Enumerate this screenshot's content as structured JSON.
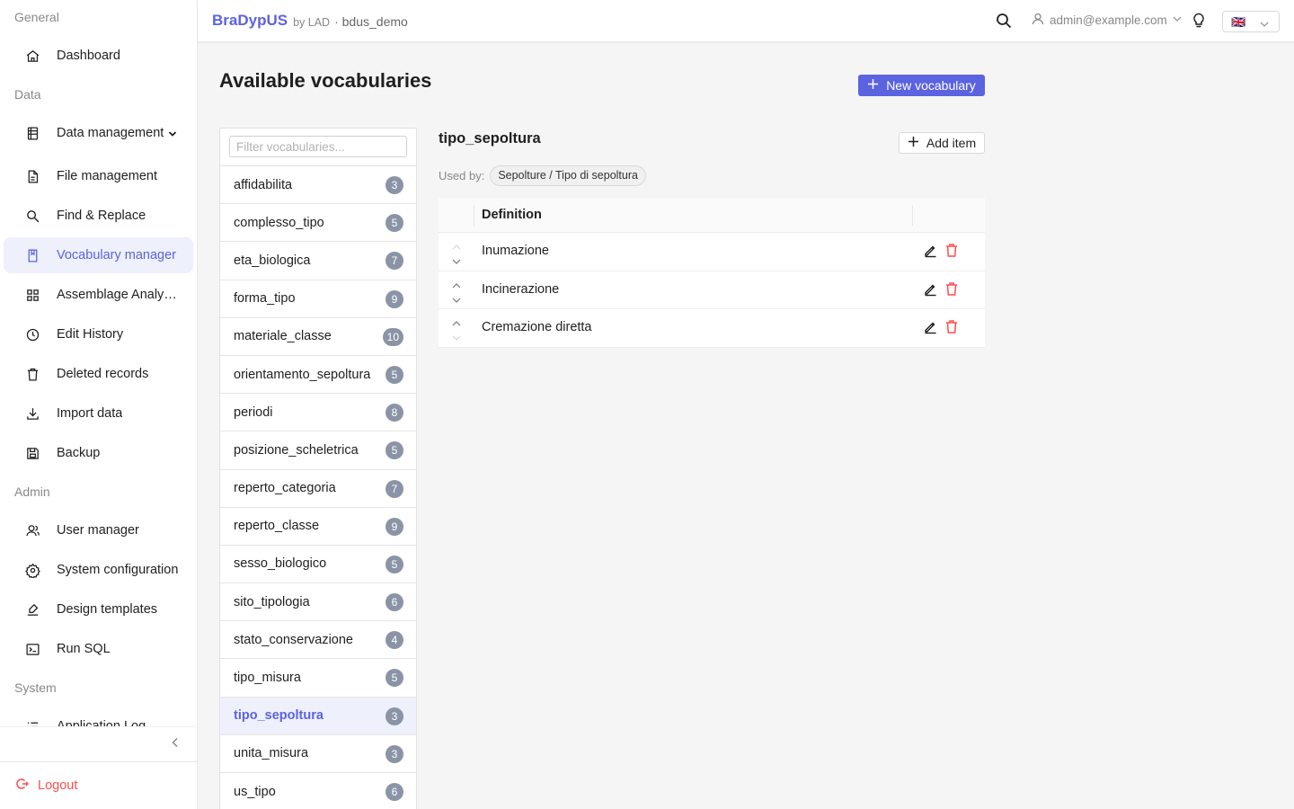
{
  "header": {
    "brand": "BraDypUS",
    "brand_by": "by LAD",
    "app_name": "· bdus_demo",
    "user": "admin@example.com",
    "language_flag": "🇬🇧"
  },
  "sidebar": {
    "groups": {
      "general": "General",
      "data": "Data",
      "admin": "Admin",
      "system": "System"
    },
    "items": {
      "dashboard": "Dashboard",
      "data_management": "Data management",
      "file_management": "File management",
      "find_replace": "Find & Replace",
      "vocabulary_manager": "Vocabulary manager",
      "assemblage": "Assemblage Analysis",
      "edit_history": "Edit History",
      "deleted_records": "Deleted records",
      "import_data": "Import data",
      "backup": "Backup",
      "user_manager": "User manager",
      "system_config": "System configuration",
      "design_templates": "Design templates",
      "run_sql": "Run SQL",
      "application_log": "Application Log"
    },
    "logout": "Logout"
  },
  "main": {
    "title": "Available vocabularies",
    "new_vocabulary": "New vocabulary",
    "filter_placeholder": "Filter vocabularies...",
    "vocabularies": [
      {
        "name": "affidabilita",
        "count": "3"
      },
      {
        "name": "complesso_tipo",
        "count": "5"
      },
      {
        "name": "eta_biologica",
        "count": "7"
      },
      {
        "name": "forma_tipo",
        "count": "9"
      },
      {
        "name": "materiale_classe",
        "count": "10"
      },
      {
        "name": "orientamento_sepoltura",
        "count": "5"
      },
      {
        "name": "periodi",
        "count": "8"
      },
      {
        "name": "posizione_scheletrica",
        "count": "5"
      },
      {
        "name": "reperto_categoria",
        "count": "7"
      },
      {
        "name": "reperto_classe",
        "count": "9"
      },
      {
        "name": "sesso_biologico",
        "count": "5"
      },
      {
        "name": "sito_tipologia",
        "count": "6"
      },
      {
        "name": "stato_conservazione",
        "count": "4"
      },
      {
        "name": "tipo_misura",
        "count": "5"
      },
      {
        "name": "tipo_sepoltura",
        "count": "3"
      },
      {
        "name": "unita_misura",
        "count": "3"
      },
      {
        "name": "us_tipo",
        "count": "6"
      }
    ],
    "active_vocabulary": "tipo_sepoltura",
    "detail": {
      "title": "tipo_sepoltura",
      "add_item": "Add item",
      "used_by_label": "Used by:",
      "used_by_tag": "Sepolture / Tipo di sepoltura",
      "column_definition": "Definition",
      "items": [
        "Inumazione",
        "Incinerazione",
        "Cremazione diretta"
      ]
    }
  },
  "colors": {
    "accent": "#5b63e0",
    "accent_bg": "#eef0fc",
    "badge": "#8b94a6",
    "danger": "#ff4d4f"
  }
}
